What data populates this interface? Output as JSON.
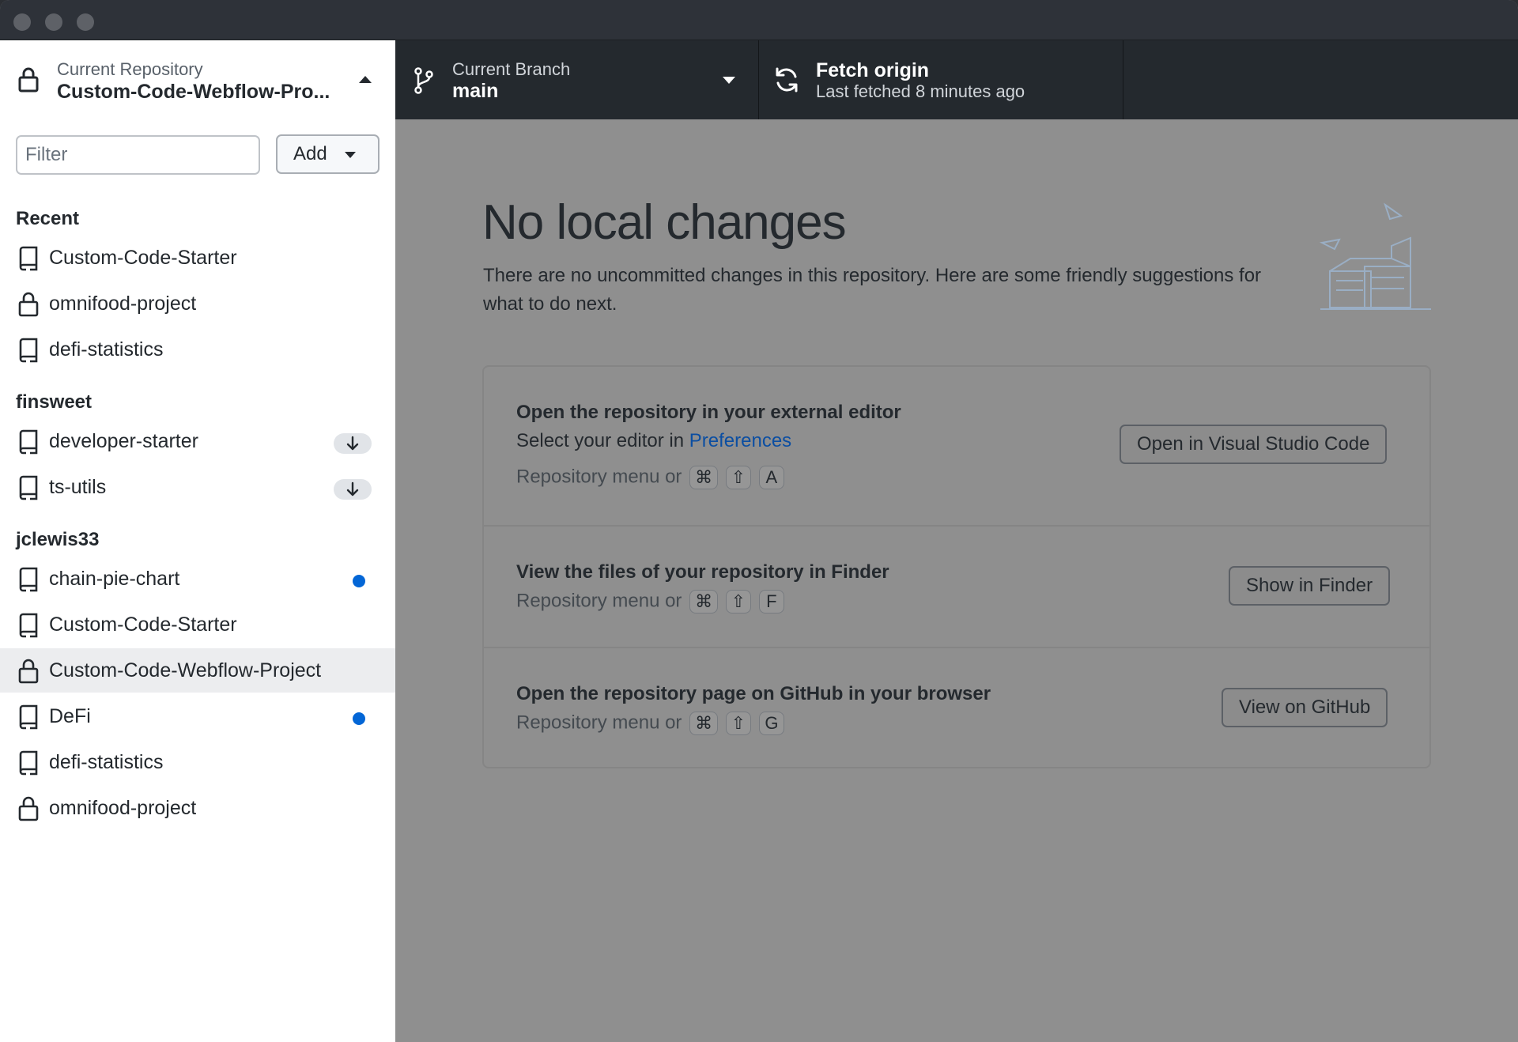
{
  "toolbar": {
    "repository": {
      "label": "Current Repository",
      "name": "Custom-Code-Webflow-Pro..."
    },
    "branch": {
      "label": "Current Branch",
      "name": "main"
    },
    "fetch": {
      "title": "Fetch origin",
      "subtitle": "Last fetched 8 minutes ago"
    }
  },
  "sidebar": {
    "filter": {
      "placeholder": "Filter",
      "value": ""
    },
    "add_label": "Add",
    "groups": [
      {
        "title": "Recent",
        "items": [
          {
            "label": "Custom-Code-Starter",
            "icon": "repo-icon"
          },
          {
            "label": "omnifood-project",
            "icon": "lock-icon"
          },
          {
            "label": "defi-statistics",
            "icon": "repo-icon"
          }
        ]
      },
      {
        "title": "finsweet",
        "items": [
          {
            "label": "developer-starter",
            "icon": "repo-icon",
            "badge": "pull-arrow"
          },
          {
            "label": "ts-utils",
            "icon": "repo-icon",
            "badge": "pull-arrow"
          }
        ]
      },
      {
        "title": "jclewis33",
        "items": [
          {
            "label": "chain-pie-chart",
            "icon": "repo-icon",
            "badge": "changes-dot"
          },
          {
            "label": "Custom-Code-Starter",
            "icon": "repo-icon"
          },
          {
            "label": "Custom-Code-Webflow-Project",
            "icon": "lock-icon",
            "selected": true
          },
          {
            "label": "DeFi",
            "icon": "repo-icon",
            "badge": "changes-dot"
          },
          {
            "label": "defi-statistics",
            "icon": "repo-icon"
          },
          {
            "label": "omnifood-project",
            "icon": "lock-icon"
          }
        ]
      }
    ]
  },
  "main": {
    "heading": "No local changes",
    "description": "There are no uncommitted changes in this repository. Here are some friendly suggestions for what to do next.",
    "suggestions": [
      {
        "title": "Open the repository in your external editor",
        "subtitle_prefix": "Select your editor in ",
        "subtitle_link": "Preferences",
        "shortcut_prefix": "Repository menu or",
        "keys": [
          "⌘",
          "⇧",
          "A"
        ],
        "button": "Open in Visual Studio Code"
      },
      {
        "title": "View the files of your repository in Finder",
        "shortcut_prefix": "Repository menu or",
        "keys": [
          "⌘",
          "⇧",
          "F"
        ],
        "button": "Show in Finder"
      },
      {
        "title": "Open the repository page on GitHub in your browser",
        "shortcut_prefix": "Repository menu or",
        "keys": [
          "⌘",
          "⇧",
          "G"
        ],
        "button": "View on GitHub"
      }
    ]
  },
  "colors": {
    "accent_blue": "#0366d6",
    "link_blue": "#0b4ea2",
    "toolbar_dark": "#24292e",
    "overlay_gray": "#8f8f8f"
  }
}
